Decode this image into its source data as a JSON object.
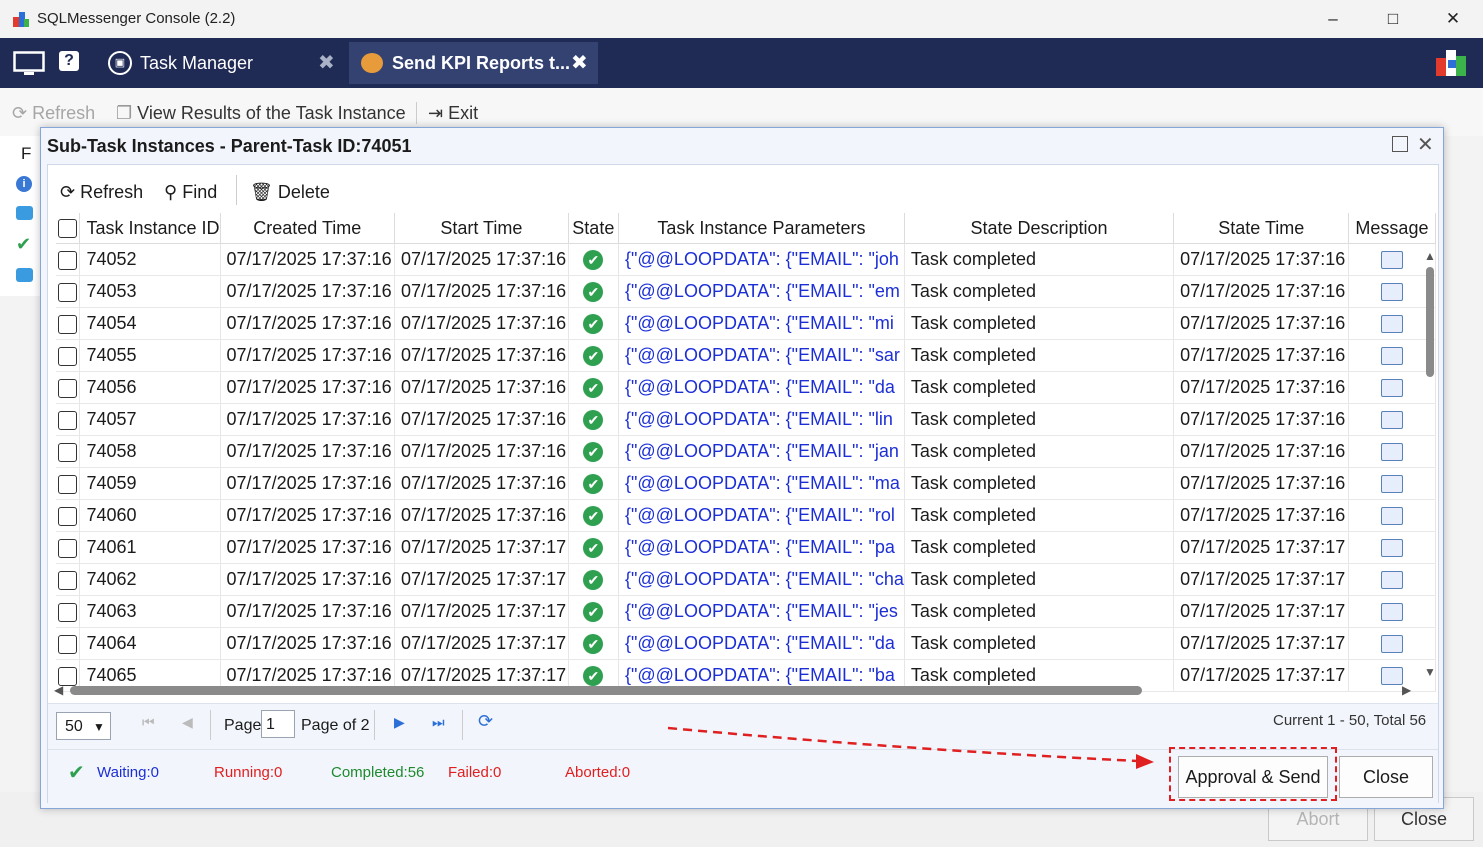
{
  "window": {
    "title": "SQLMessenger Console (2.2)"
  },
  "app_tabs": [
    {
      "label": "Task Manager"
    },
    {
      "label": "Send KPI Reports t..."
    }
  ],
  "toolbar": {
    "refresh": "Refresh",
    "view_results": "View Results of the Task Instance",
    "exit": "Exit"
  },
  "bg": {
    "column_initial": "F",
    "abort": "Abort",
    "close": "Close"
  },
  "dialog": {
    "title": "Sub-Task Instances - Parent-Task ID:74051",
    "toolbar": {
      "refresh": "Refresh",
      "find": "Find",
      "delete": "Delete"
    },
    "columns": [
      "Task Instance ID",
      "Created Time",
      "Start Time",
      "State",
      "Task Instance Parameters",
      "State Description",
      "State Time",
      "Message"
    ],
    "rows": [
      {
        "id": "74052",
        "created": "07/17/2025 17:37:16",
        "start": "07/17/2025 17:37:16",
        "params": "{\"@@LOOPDATA\": {\"EMAIL\": \"joh",
        "desc": "Task completed",
        "state_time": "07/17/2025 17:37:16"
      },
      {
        "id": "74053",
        "created": "07/17/2025 17:37:16",
        "start": "07/17/2025 17:37:16",
        "params": "{\"@@LOOPDATA\": {\"EMAIL\": \"em",
        "desc": "Task completed",
        "state_time": "07/17/2025 17:37:16"
      },
      {
        "id": "74054",
        "created": "07/17/2025 17:37:16",
        "start": "07/17/2025 17:37:16",
        "params": "{\"@@LOOPDATA\": {\"EMAIL\": \"mi",
        "desc": "Task completed",
        "state_time": "07/17/2025 17:37:16"
      },
      {
        "id": "74055",
        "created": "07/17/2025 17:37:16",
        "start": "07/17/2025 17:37:16",
        "params": "{\"@@LOOPDATA\": {\"EMAIL\": \"sar",
        "desc": "Task completed",
        "state_time": "07/17/2025 17:37:16"
      },
      {
        "id": "74056",
        "created": "07/17/2025 17:37:16",
        "start": "07/17/2025 17:37:16",
        "params": "{\"@@LOOPDATA\": {\"EMAIL\": \"da",
        "desc": "Task completed",
        "state_time": "07/17/2025 17:37:16"
      },
      {
        "id": "74057",
        "created": "07/17/2025 17:37:16",
        "start": "07/17/2025 17:37:16",
        "params": "{\"@@LOOPDATA\": {\"EMAIL\": \"lin",
        "desc": "Task completed",
        "state_time": "07/17/2025 17:37:16"
      },
      {
        "id": "74058",
        "created": "07/17/2025 17:37:16",
        "start": "07/17/2025 17:37:16",
        "params": "{\"@@LOOPDATA\": {\"EMAIL\": \"jan",
        "desc": "Task completed",
        "state_time": "07/17/2025 17:37:16"
      },
      {
        "id": "74059",
        "created": "07/17/2025 17:37:16",
        "start": "07/17/2025 17:37:16",
        "params": "{\"@@LOOPDATA\": {\"EMAIL\": \"ma",
        "desc": "Task completed",
        "state_time": "07/17/2025 17:37:16"
      },
      {
        "id": "74060",
        "created": "07/17/2025 17:37:16",
        "start": "07/17/2025 17:37:16",
        "params": "{\"@@LOOPDATA\": {\"EMAIL\": \"rol",
        "desc": "Task completed",
        "state_time": "07/17/2025 17:37:16"
      },
      {
        "id": "74061",
        "created": "07/17/2025 17:37:16",
        "start": "07/17/2025 17:37:17",
        "params": "{\"@@LOOPDATA\": {\"EMAIL\": \"pa",
        "desc": "Task completed",
        "state_time": "07/17/2025 17:37:17"
      },
      {
        "id": "74062",
        "created": "07/17/2025 17:37:16",
        "start": "07/17/2025 17:37:17",
        "params": "{\"@@LOOPDATA\": {\"EMAIL\": \"cha",
        "desc": "Task completed",
        "state_time": "07/17/2025 17:37:17"
      },
      {
        "id": "74063",
        "created": "07/17/2025 17:37:16",
        "start": "07/17/2025 17:37:17",
        "params": "{\"@@LOOPDATA\": {\"EMAIL\": \"jes",
        "desc": "Task completed",
        "state_time": "07/17/2025 17:37:17"
      },
      {
        "id": "74064",
        "created": "07/17/2025 17:37:16",
        "start": "07/17/2025 17:37:17",
        "params": "{\"@@LOOPDATA\": {\"EMAIL\": \"da",
        "desc": "Task completed",
        "state_time": "07/17/2025 17:37:17"
      },
      {
        "id": "74065",
        "created": "07/17/2025 17:37:16",
        "start": "07/17/2025 17:37:17",
        "params": "{\"@@LOOPDATA\": {\"EMAIL\": \"ba",
        "desc": "Task completed",
        "state_time": "07/17/2025 17:37:17"
      }
    ],
    "pager": {
      "page_size": "50",
      "page_label": "Page",
      "page_value": "1",
      "page_of": "Page of 2",
      "summary": "Current 1 - 50, Total 56"
    },
    "status": {
      "waiting": "Waiting:0",
      "running": "Running:0",
      "completed": "Completed:56",
      "failed": "Failed:0",
      "aborted": "Aborted:0"
    },
    "buttons": {
      "approval_send": "Approval & Send",
      "close": "Close"
    }
  },
  "colors": {
    "appbar": "#1f2b54",
    "param_text": "#1c2fd6",
    "ok_green": "#2ea04f",
    "highlight_red": "#e02020"
  }
}
